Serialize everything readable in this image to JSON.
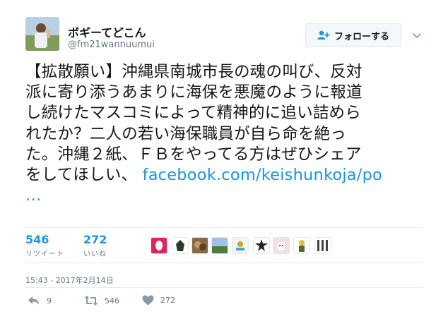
{
  "user": {
    "display_name": "ボギーてどこん",
    "handle": "@fm21wannuumui"
  },
  "follow_button": {
    "label": "フォローする"
  },
  "tweet": {
    "lines": [
      "【拡散願い】沖縄県南城市長の魂の叫び、反対",
      "派に寄り添うあまりに海保を悪魔のように報道",
      "し続けたマスコミによって精神的に追い詰めら",
      "れたか？二人の若い海保職員が自ら命を絶っ",
      "た。沖縄２紙、ＦＢをやってる方はぜひシェア"
    ],
    "last_line_prefix": "をしてほしい、 ",
    "link_text": "facebook.com/keishunkoja/po",
    "ellipsis": "…"
  },
  "stats": {
    "retweets": {
      "count": "546",
      "label": "リツイート"
    },
    "likes": {
      "count": "272",
      "label": "いいね"
    }
  },
  "timestamp": "15:43 - 2017年2月14日",
  "actions": {
    "reply_count": "9",
    "retweet_count": "546",
    "like_count": "272"
  },
  "colors": {
    "link": "#1b95e0",
    "secondary_text": "#657786",
    "divider": "#e6ecf0"
  },
  "icons": {
    "follow": "person-add-icon",
    "more": "chevron-down-icon",
    "reply": "reply-icon",
    "retweet": "retweet-icon",
    "like": "heart-icon"
  }
}
